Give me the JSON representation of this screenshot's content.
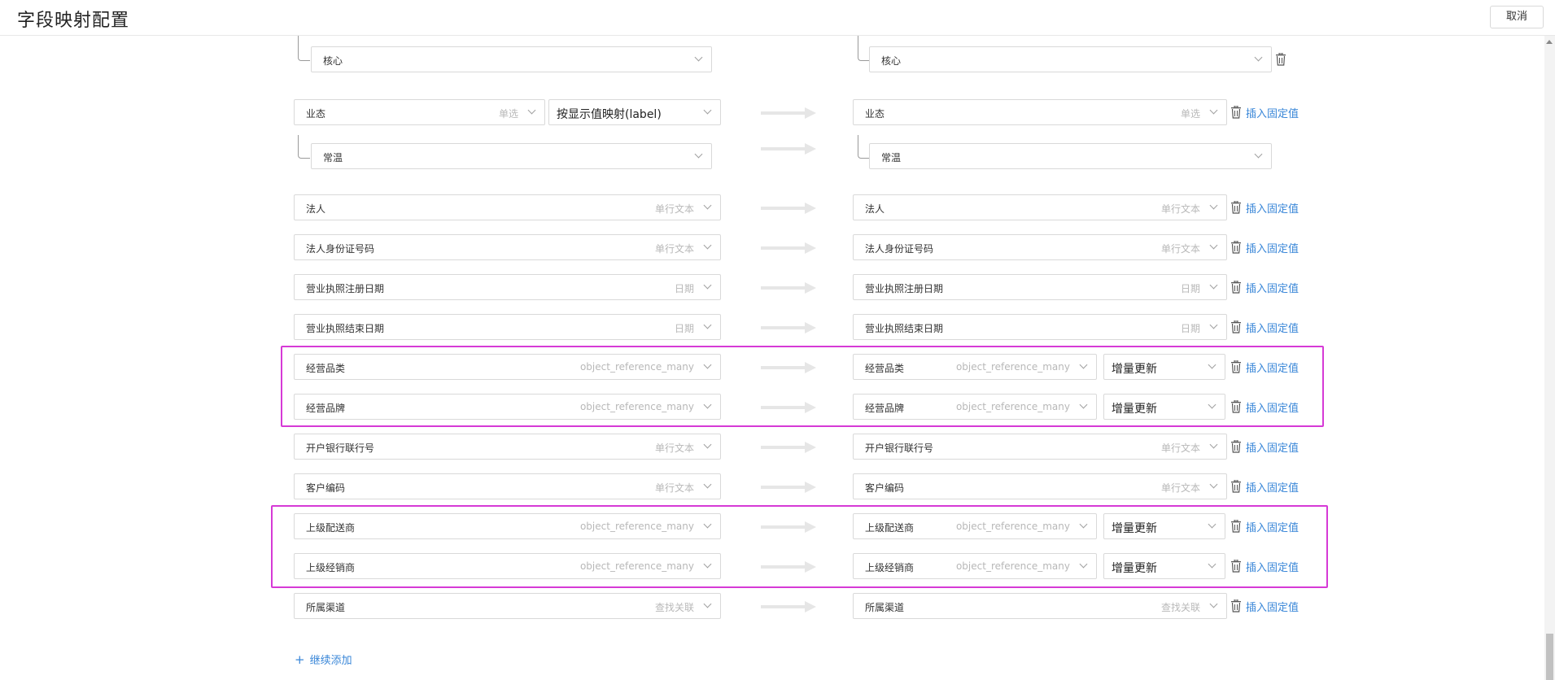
{
  "header": {
    "title": "字段映射配置",
    "cancel_label": "取消"
  },
  "mapping_mode_label": "按显示值映射(label)",
  "nested_rows": [
    {
      "source_value": "核心",
      "target_value": "核心"
    }
  ],
  "option_field": {
    "label": "业态",
    "type": "单选",
    "sub_source": "常温",
    "sub_target": "常温"
  },
  "rows": [
    {
      "source": "法人",
      "type": "单行文本",
      "target": "法人",
      "target_type": "单行文本"
    },
    {
      "source": "法人身份证号码",
      "type": "单行文本",
      "target": "法人身份证号码",
      "target_type": "单行文本"
    },
    {
      "source": "营业执照注册日期",
      "type": "日期",
      "target": "营业执照注册日期",
      "target_type": "日期"
    },
    {
      "source": "营业执照结束日期",
      "type": "日期",
      "target": "营业执照结束日期",
      "target_type": "日期"
    },
    {
      "source": "经营品类",
      "type": "object_reference_many",
      "target": "经营品类",
      "target_type": "object_reference_many",
      "update_mode": "增量更新"
    },
    {
      "source": "经营品牌",
      "type": "object_reference_many",
      "target": "经营品牌",
      "target_type": "object_reference_many",
      "update_mode": "增量更新"
    },
    {
      "source": "开户银行联行号",
      "type": "单行文本",
      "target": "开户银行联行号",
      "target_type": "单行文本"
    },
    {
      "source": "客户编码",
      "type": "单行文本",
      "target": "客户编码",
      "target_type": "单行文本"
    },
    {
      "source": "上级配送商",
      "type": "object_reference_many",
      "target": "上级配送商",
      "target_type": "object_reference_many",
      "update_mode": "增量更新"
    },
    {
      "source": "上级经销商",
      "type": "object_reference_many",
      "target": "上级经销商",
      "target_type": "object_reference_many",
      "update_mode": "增量更新"
    },
    {
      "source": "所属渠道",
      "type": "查找关联",
      "target": "所属渠道",
      "target_type": "查找关联"
    }
  ],
  "insert_fixed_label": "插入固定值",
  "add_more_label": "继续添加",
  "colors": {
    "link": "#3a87d8",
    "highlight": "#d63ad6",
    "border": "#d9d9d9"
  },
  "icons": [
    "trash-icon",
    "arrow-right-icon",
    "chevron-down-icon",
    "plus-icon"
  ]
}
